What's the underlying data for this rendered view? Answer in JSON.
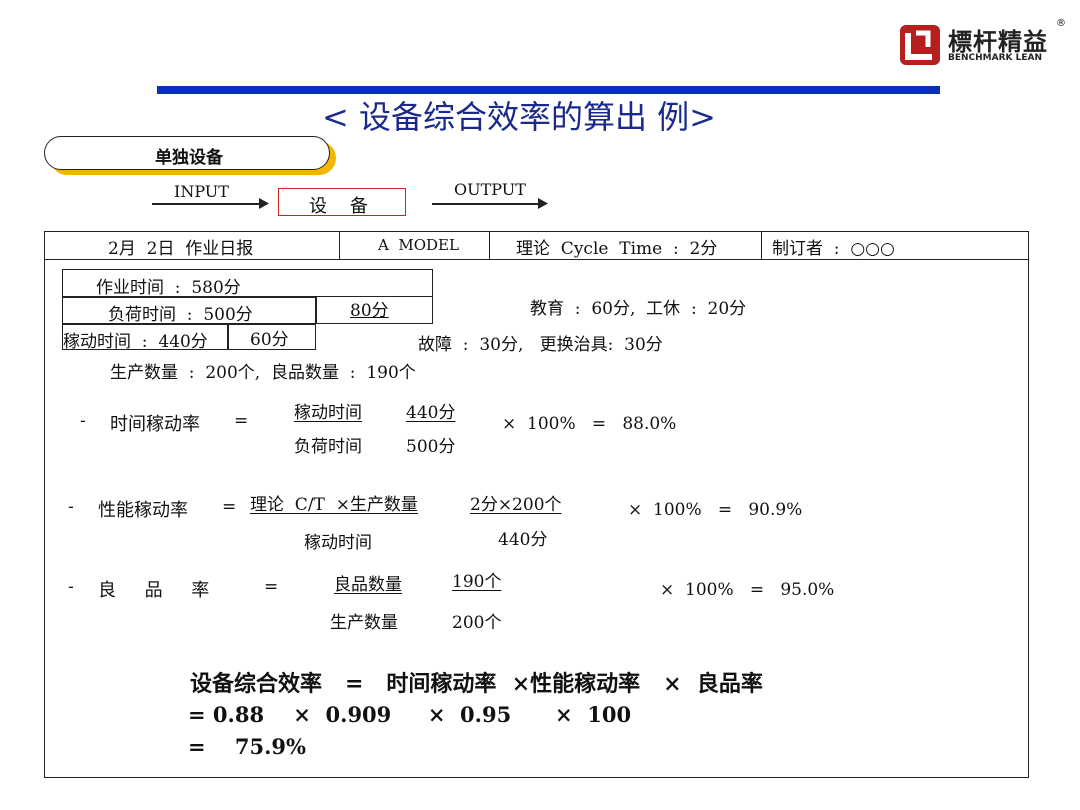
{
  "logo": {
    "cn": "標杆精益",
    "en": "BENCHMARK LEAN",
    "reg": "®"
  },
  "title": "< 设备综合效率的算出  例>",
  "pill_label": "单独设备",
  "flow": {
    "input": "INPUT",
    "equipment": "设    备",
    "output": "OUTPUT"
  },
  "header": {
    "date": "2月  2日  作业日报",
    "model": "A  MODEL",
    "cycle": "理论  Cycle  Time  :  2分",
    "author": "制订者  :  ○○○"
  },
  "times": {
    "work": "作业时间  :  580分",
    "load": "负荷时间  :  500分",
    "diff1": "80分",
    "uptime": "稼动时间  :  440分",
    "diff2": "60分",
    "note1": "教育  :  60分,  工休  :  20分",
    "note2": "故障  :  30分,   更换治具:  30分",
    "production": "生产数量  :  200个,  良品数量  :  190个"
  },
  "formula1": {
    "dash": "-",
    "label": "时间稼动率",
    "eq": "=",
    "num_text": "稼动时间",
    "num_val": "440分",
    "den_text": "负荷时间",
    "den_val": "500分",
    "tail": "×  100%   =   88.0%"
  },
  "formula2": {
    "dash": "-",
    "label": "性能稼动率",
    "eq": "=",
    "num_text": "理论  C/T  ×生产数量",
    "num_val": "2分×200个",
    "den_text": "稼动时间",
    "den_val": "440分",
    "tail": "×  100%   =   90.9%"
  },
  "formula3": {
    "dash": "-",
    "label": "良     品     率",
    "eq": "=",
    "num_text": "良品数量",
    "num_val": "190个",
    "den_text": "生产数量",
    "den_val": "200个",
    "tail": "×  100%   =   95.0%"
  },
  "summary": {
    "line1": "设备综合效率   =   时间稼动率  ×性能稼动率   ×  良品率",
    "line2": "= 0.88    ×  0.909     ×  0.95      ×  100",
    "line3": "=    75.9%"
  },
  "colors": {
    "blue_bar": "#0a2fb8",
    "pill_shadow": "#f2b600",
    "red_box": "#d62020",
    "logo_red": "#b5201e"
  }
}
